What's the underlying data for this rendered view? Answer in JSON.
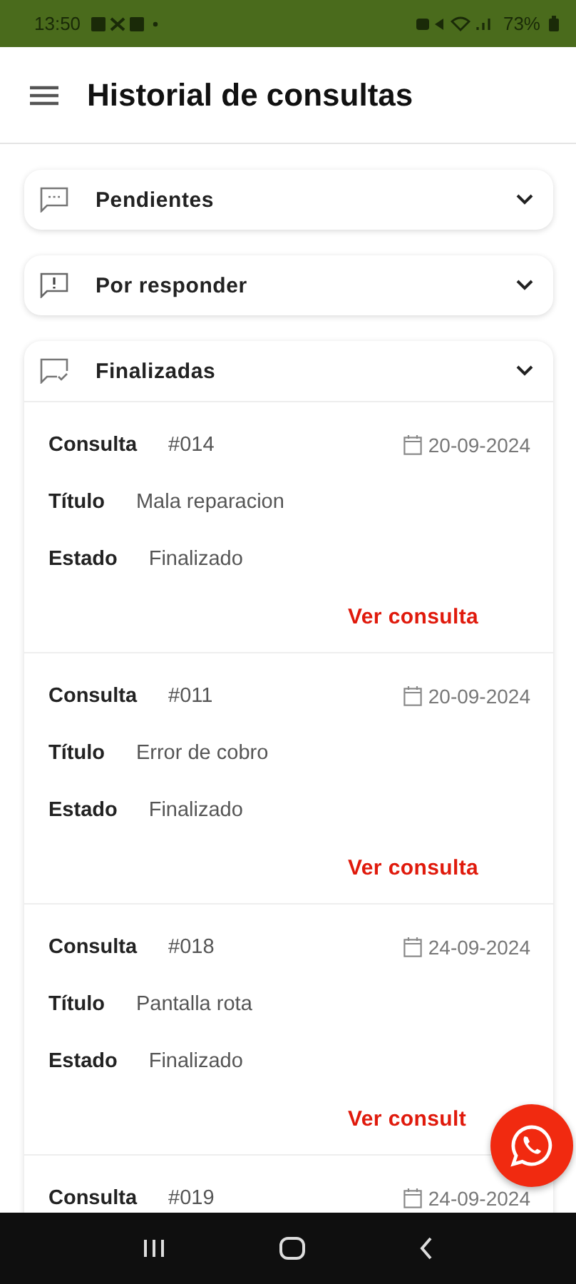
{
  "status_bar": {
    "time": "13:50",
    "battery": "73%"
  },
  "app_bar": {
    "title": "Historial de consultas"
  },
  "sections": [
    {
      "kind": "pending",
      "label": "Pendientes"
    },
    {
      "kind": "unanswered",
      "label": "Por responder"
    },
    {
      "kind": "done",
      "label": "Finalizadas",
      "items": [
        {
          "consulta_label": "Consulta",
          "number": "#014",
          "date": "20-09-2024",
          "title_label": "Título",
          "title": "Mala reparacion",
          "status_label": "Estado",
          "status": "Finalizado",
          "link": "Ver consulta"
        },
        {
          "consulta_label": "Consulta",
          "number": "#011",
          "date": "20-09-2024",
          "title_label": "Título",
          "title": "Error de cobro",
          "status_label": "Estado",
          "status": "Finalizado",
          "link": "Ver consulta"
        },
        {
          "consulta_label": "Consulta",
          "number": "#018",
          "date": "24-09-2024",
          "title_label": "Título",
          "title": "Pantalla rota",
          "status_label": "Estado",
          "status": "Finalizado",
          "link": "Ver consult"
        },
        {
          "consulta_label": "Consulta",
          "number": "#019",
          "date": "24-09-2024"
        }
      ]
    }
  ]
}
